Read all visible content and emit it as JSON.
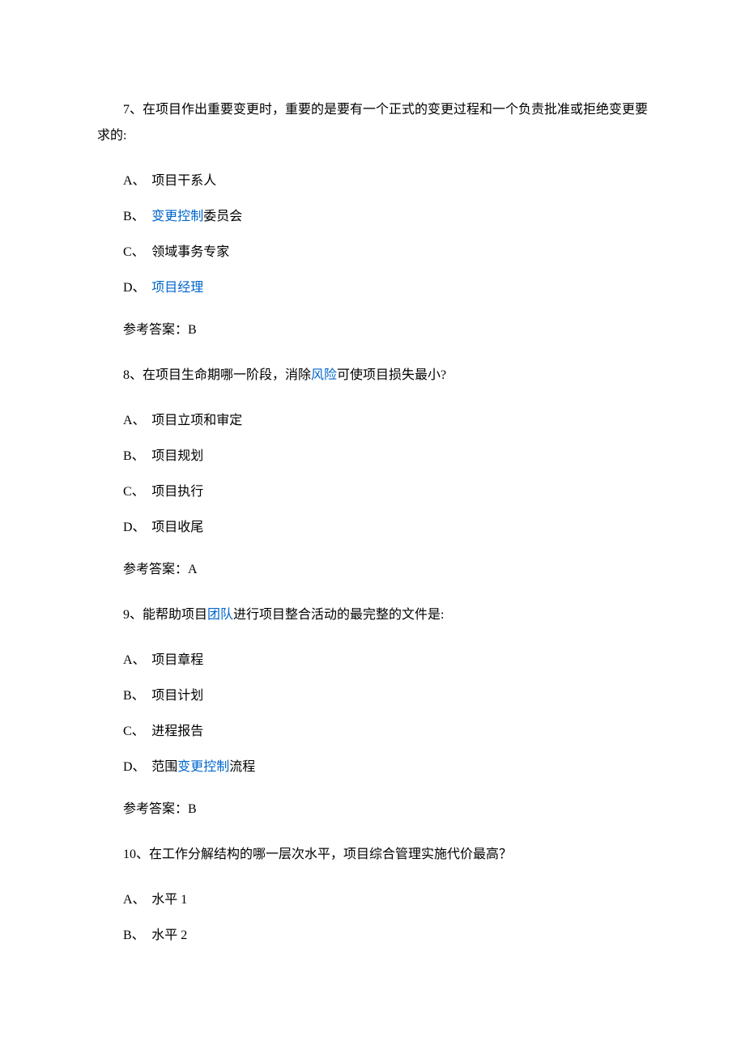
{
  "q7": {
    "text_p1": "7、在项目作出重要变更时，重要的是要有一个正式的变更过程和一个负责批准或拒绝变更要求的:",
    "opt_a_label": "A、",
    "opt_a_text": "项目干系人",
    "opt_b_label": "B、",
    "opt_b_link": "变更控制",
    "opt_b_after": "委员会",
    "opt_c_label": "C、",
    "opt_c_text": "领域事务专家",
    "opt_d_label": "D、",
    "opt_d_link": "项目经理",
    "answer": "参考答案：B"
  },
  "q8": {
    "text_before": "8、在项目生命期哪一阶段，消除",
    "text_link": "风险",
    "text_after": "可使项目损失最小?",
    "opt_a_label": "A、",
    "opt_a_text": "项目立项和审定",
    "opt_b_label": "B、",
    "opt_b_text": "项目规划",
    "opt_c_label": "C、",
    "opt_c_text": "项目执行",
    "opt_d_label": "D、",
    "opt_d_text": "项目收尾",
    "answer": "参考答案：A"
  },
  "q9": {
    "text_before": "9、能帮助项目",
    "text_link": "团队",
    "text_after": "进行项目整合活动的最完整的文件是:",
    "opt_a_label": "A、",
    "opt_a_text": "项目章程",
    "opt_b_label": "B、",
    "opt_b_text": "项目计划",
    "opt_c_label": "C、",
    "opt_c_text": "进程报告",
    "opt_d_label": "D、",
    "opt_d_before": "范围",
    "opt_d_link": "变更控制",
    "opt_d_after": "流程",
    "answer": "参考答案：B"
  },
  "q10": {
    "text": "10、在工作分解结构的哪一层次水平，项目综合管理实施代价最高？",
    "opt_a_label": "A、",
    "opt_a_text": "水平 1",
    "opt_b_label": "B、",
    "opt_b_text": "水平 2"
  }
}
